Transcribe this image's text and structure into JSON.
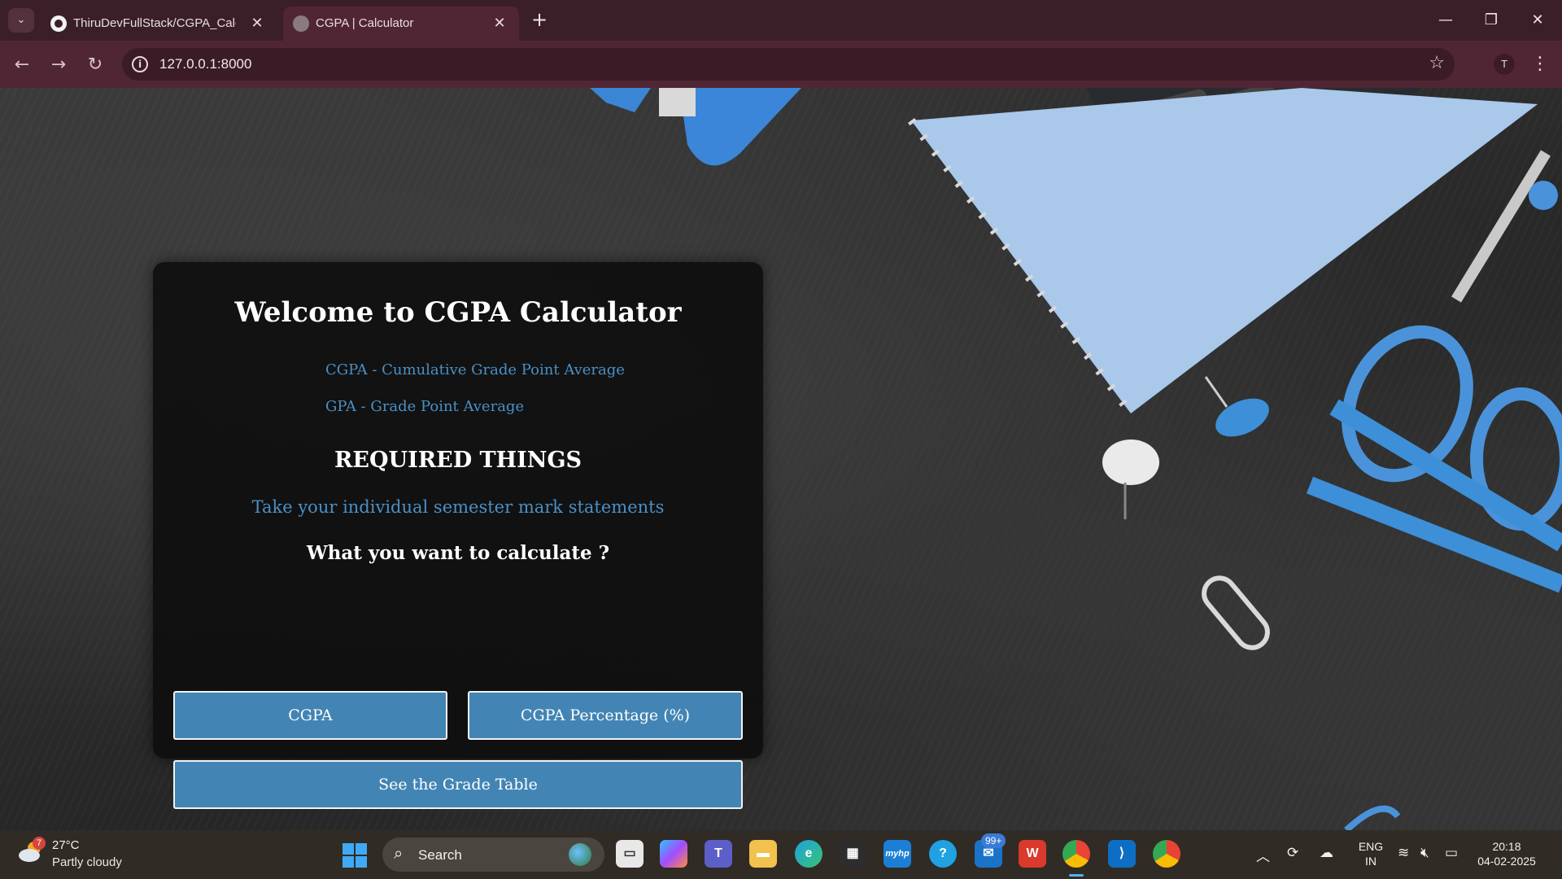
{
  "browser": {
    "tabs": [
      {
        "title": "ThiruDevFullStack/CGPA_Calcul",
        "active": false
      },
      {
        "title": "CGPA | Calculator",
        "active": true
      }
    ],
    "url": "127.0.0.1:8000",
    "profile_initial": "T"
  },
  "page": {
    "title": "Welcome to CGPA Calculator",
    "abbreviations": [
      "CGPA - Cumulative Grade Point Average",
      "GPA - Grade Point Average"
    ],
    "required_heading": "REQUIRED THINGS",
    "required_text": "Take your individual semester mark statements",
    "question": "What you want to calculate ?",
    "buttons": {
      "cgpa": "CGPA",
      "cgpa_percentage": "CGPA Percentage (%)",
      "grade_table": "See the Grade Table"
    },
    "colors": {
      "accent": "#4285b4",
      "link": "#4a90c6",
      "card": "#0e0e0e"
    }
  },
  "taskbar": {
    "weather": {
      "temp": "27°C",
      "desc": "Partly cloudy",
      "badge": "7"
    },
    "search_placeholder": "Search",
    "mail_badge": "99+",
    "language": {
      "line1": "ENG",
      "line2": "IN"
    },
    "clock": {
      "time": "20:18",
      "date": "04-02-2025"
    }
  }
}
